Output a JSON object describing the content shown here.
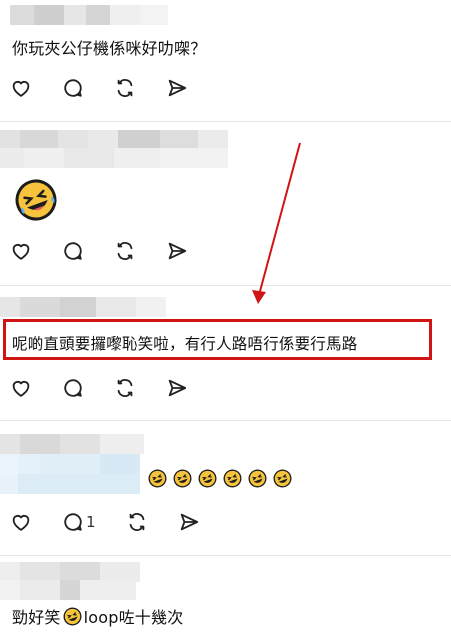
{
  "posts": [
    {
      "text": "你玩夾公仔機係咪好叻㗎？",
      "replies": ""
    },
    {
      "text": "",
      "emoji": "rolling-on-floor-laughing",
      "replies": ""
    },
    {
      "text": "呢啲直頭要攞嚟恥笑啦，有行人路唔行係要行馬路",
      "replies": "",
      "highlighted": true
    },
    {
      "text": "",
      "emoji_row_count": 6,
      "emoji": "rolling-on-floor-laughing",
      "replies": "1"
    },
    {
      "text_before": "勁好笑",
      "emoji": "rolling-on-floor-laughing",
      "text_after": "loop咗十幾次"
    }
  ],
  "icons": {
    "like": "heart-icon",
    "reply": "comment-icon",
    "repost": "repost-icon",
    "share": "send-icon"
  },
  "colors": {
    "highlight": "#d01414",
    "arrow": "#d01414"
  }
}
